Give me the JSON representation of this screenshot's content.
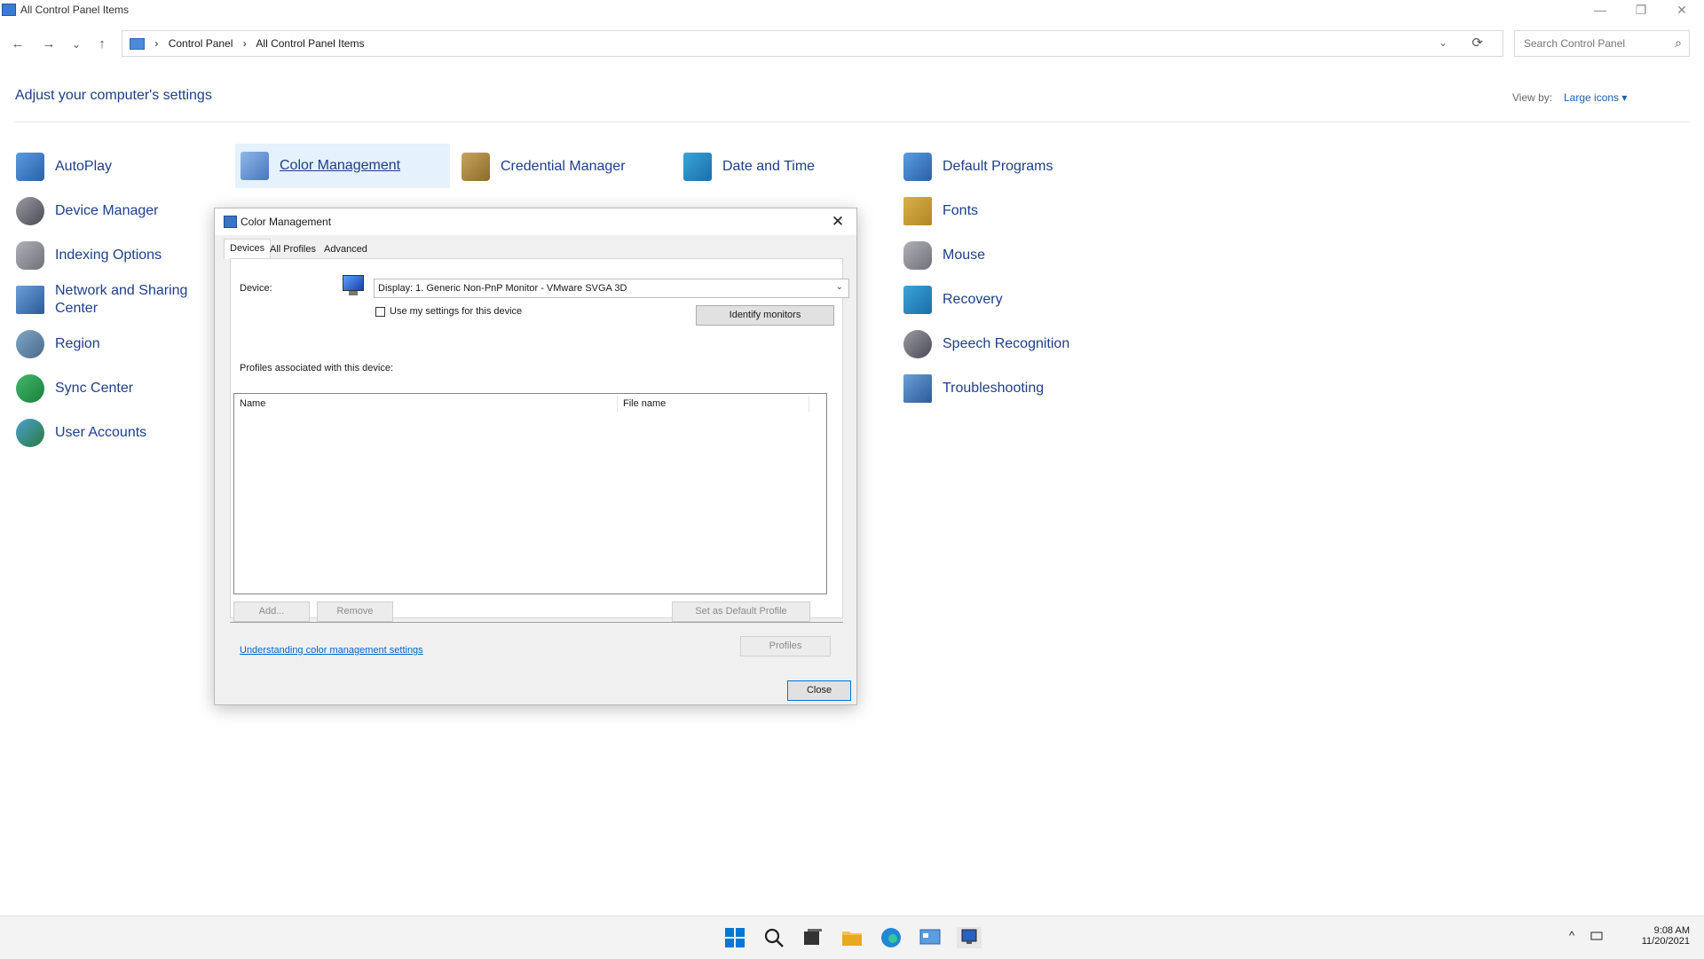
{
  "window": {
    "title": "All Control Panel Items",
    "minimize": "—",
    "restore": "❐",
    "close": "✕"
  },
  "nav": {
    "back": "←",
    "forward": "→",
    "recent": "⌄",
    "up": "↑"
  },
  "address": {
    "crumbs": [
      "Control Panel",
      "All Control Panel Items"
    ],
    "separator": "›",
    "dropdown": "⌄",
    "refresh": "⟳"
  },
  "search": {
    "placeholder": "Search Control Panel",
    "icon": "⌕"
  },
  "main": {
    "heading": "Adjust your computer's settings",
    "view_by_label": "View by:",
    "view_by_value": "Large icons ▾"
  },
  "items": {
    "autoplay": "AutoPlay",
    "color_management": "Color Management",
    "credential_manager": "Credential Manager",
    "date_time": "Date and Time",
    "default_programs": "Default Programs",
    "device_manager": "Device Manager",
    "fonts": "Fonts",
    "indexing_options": "Indexing Options",
    "mouse": "Mouse",
    "network_sharing": "Network and Sharing Center",
    "recovery": "Recovery",
    "region": "Region",
    "speech_recognition": "Speech Recognition",
    "sync_center": "Sync Center",
    "troubleshooting": "Troubleshooting",
    "user_accounts": "User Accounts"
  },
  "dialog": {
    "title": "Color Management",
    "close_x": "✕",
    "tabs": [
      "Devices",
      "All Profiles",
      "Advanced"
    ],
    "device_label": "Device:",
    "device_value": "Display: 1. Generic Non-PnP Monitor - VMware SVGA 3D",
    "device_chevron": "⌄",
    "use_settings": "Use my settings for this device",
    "identify": "Identify monitors",
    "profiles_label": "Profiles associated with this device:",
    "columns": [
      "Name",
      "File name"
    ],
    "add": "Add...",
    "remove": "Remove",
    "set_default": "Set as Default Profile",
    "link": "Understanding color management settings",
    "profiles_button": "Profiles",
    "close_button": "Close"
  },
  "tray": {
    "time": "9:08 AM",
    "date": "11/20/2021",
    "chevron": "^"
  }
}
